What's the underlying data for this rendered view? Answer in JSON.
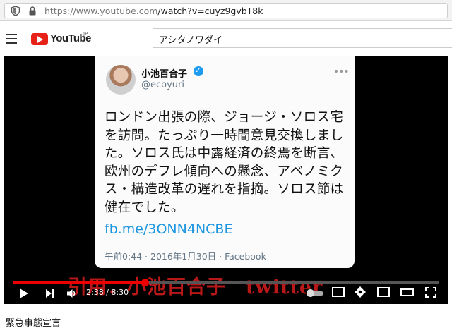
{
  "browser": {
    "url_base": "https://www.youtube.com",
    "url_path": "/watch?v=cuyz9gvbT8k"
  },
  "header": {
    "logo_text": "YouTube",
    "logo_region": "JP",
    "search_value": "アシタノワダイ"
  },
  "tweet": {
    "name": "小池百合子",
    "handle": "@ecoyuri",
    "more": "•••",
    "body": "ロンドン出張の際、ジョージ・ソロス宅を訪問。たっぷり一時間意見交換しました。ソロス氏は中露経済の終焉を断言、欧州のデフレ傾向への懸念、アベノミクス・構造改革の遅れを指摘。ソロス節は健在でした。",
    "link": "fb.me/3ONN4NCBE",
    "meta": "午前0:44 · 2016年1月30日 · Facebook"
  },
  "subtitle": "引用：小池百合子　twitter",
  "player": {
    "time": "2:38 / 8:30",
    "progress": 0.31
  },
  "video_title": "緊急事態宣言",
  "colors": {
    "brand_red": "#e62117",
    "subtitle_red": "#c21a1a",
    "link_blue": "#1b95e0"
  }
}
